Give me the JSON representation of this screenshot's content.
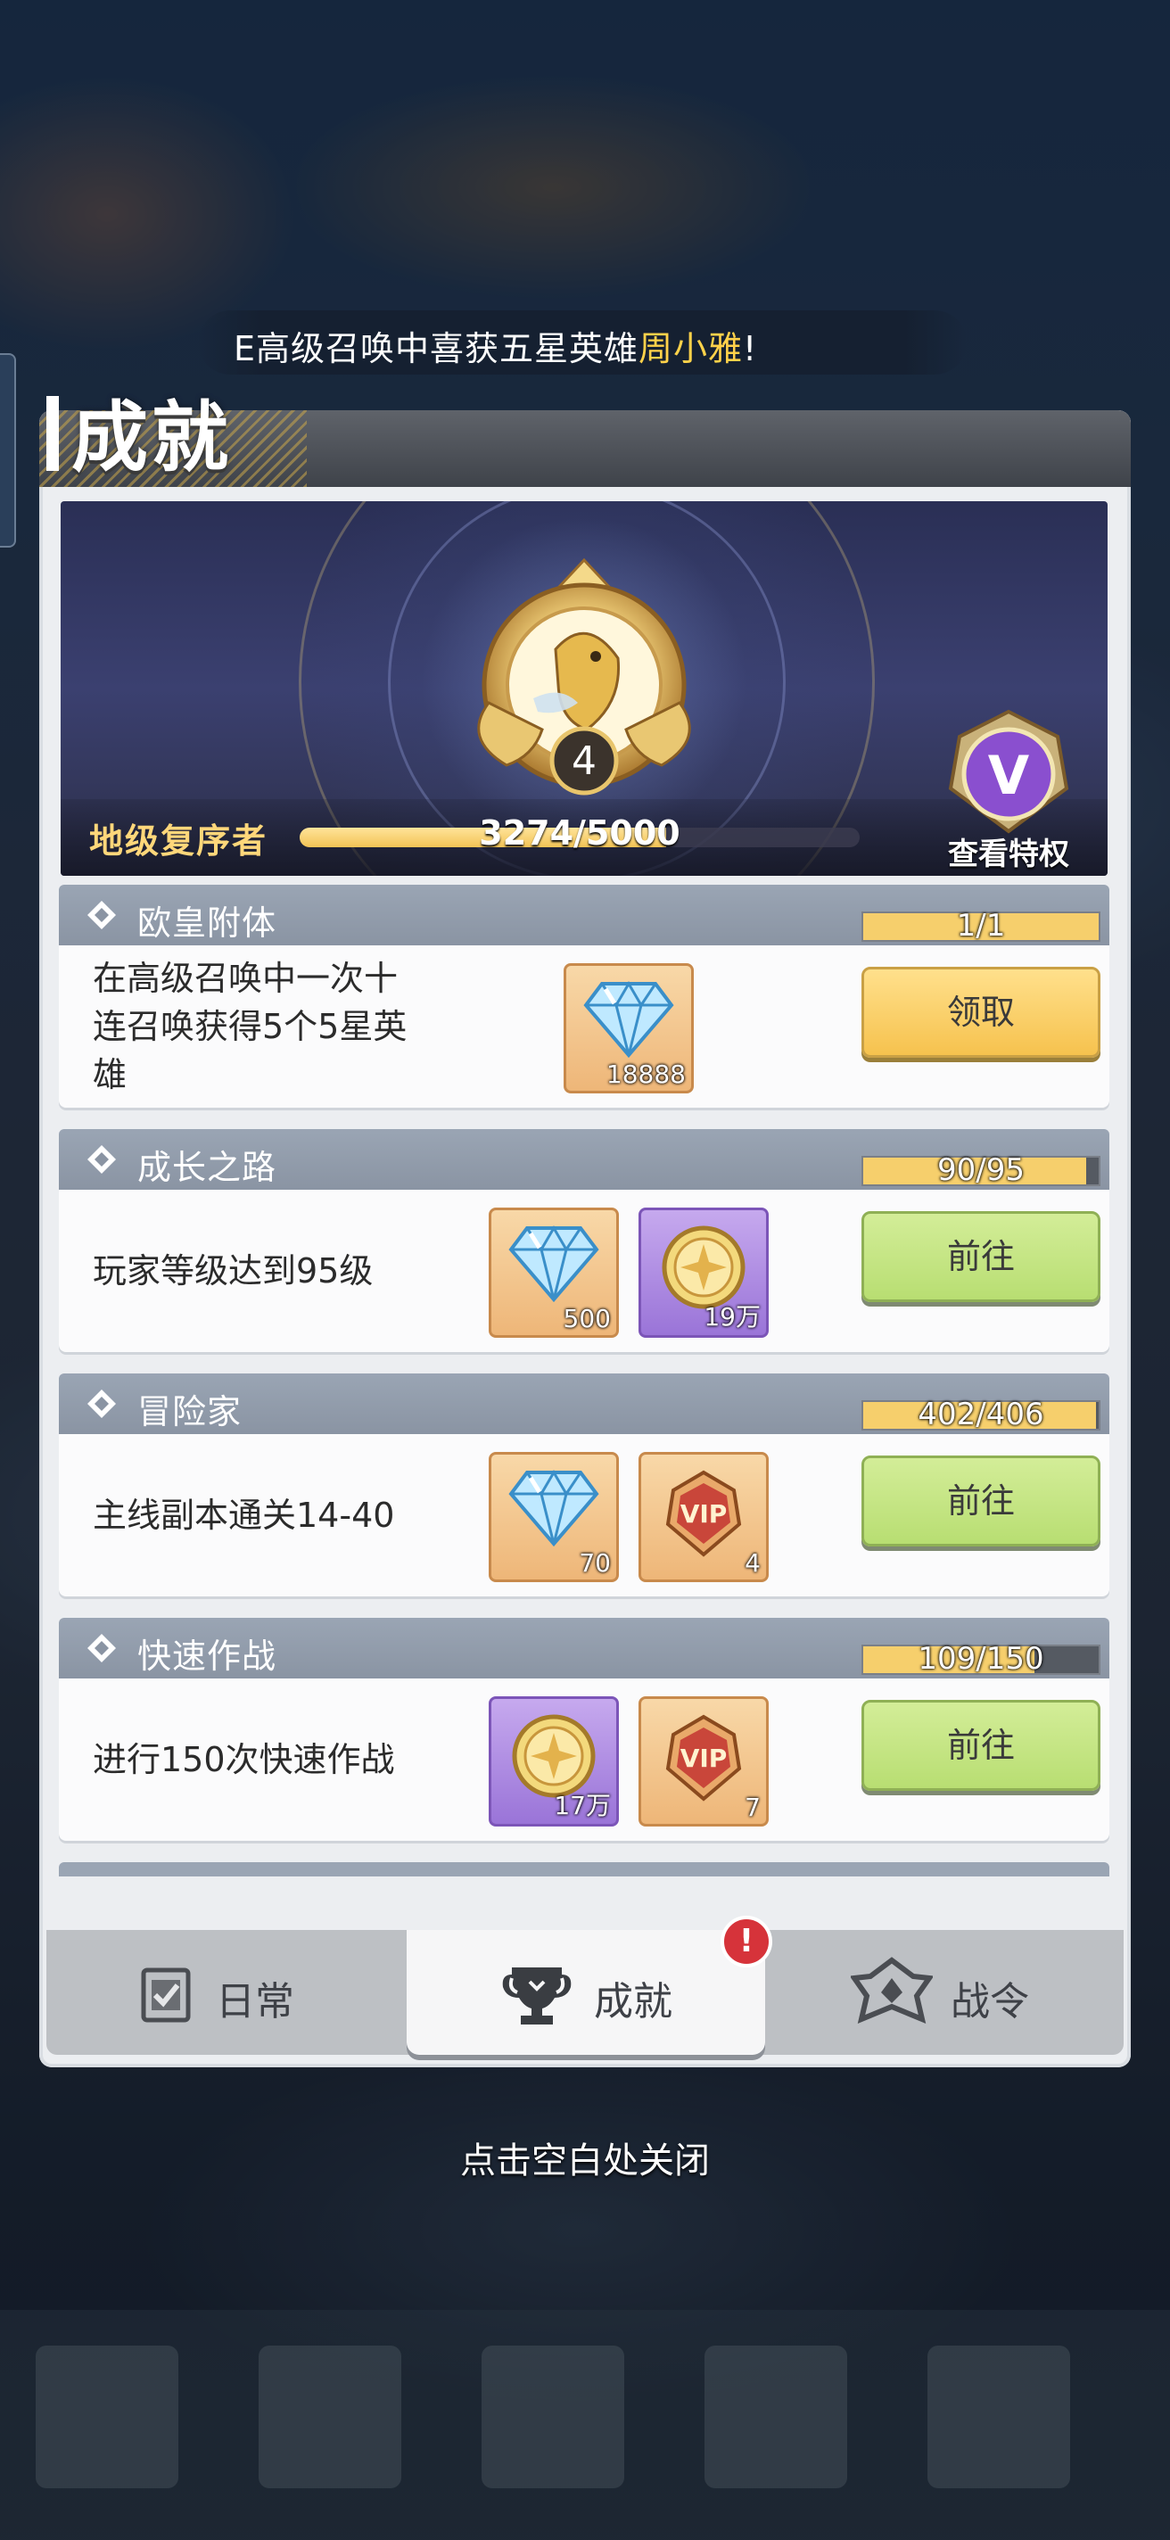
{
  "broadcast": {
    "prefix": "E高级召唤中喜获五星英雄",
    "hero": "周小雅",
    "suffix": "!"
  },
  "title": "成就",
  "banner": {
    "level": "4",
    "rank_name": "地级复序者",
    "exp_text": "3274/5000",
    "exp_fraction": 0.6548,
    "vip_letter": "V",
    "vip_label": "查看特权"
  },
  "achievements": [
    {
      "category": "欧皇附体",
      "desc_lines": [
        "在高级召唤中一次十",
        "连召唤获得5个5星英",
        "雄"
      ],
      "rewards": [
        {
          "type": "diamond-icon",
          "style": "orange",
          "count": "18888"
        }
      ],
      "progress_text": "1/1",
      "progress_fraction": 1.0,
      "action": "领取",
      "action_kind": "claim"
    },
    {
      "category": "成长之路",
      "desc_lines": [
        "玩家等级达到95级"
      ],
      "rewards": [
        {
          "type": "diamond-icon",
          "style": "orange",
          "count": "500"
        },
        {
          "type": "gold-coin-icon",
          "style": "purple",
          "count": "19万"
        }
      ],
      "progress_text": "90/95",
      "progress_fraction": 0.947,
      "action": "前往",
      "action_kind": "go"
    },
    {
      "category": "冒险家",
      "desc_lines": [
        "主线副本通关14-40"
      ],
      "rewards": [
        {
          "type": "diamond-icon",
          "style": "orange",
          "count": "70"
        },
        {
          "type": "vip-badge-icon",
          "style": "orange",
          "count": "4"
        }
      ],
      "progress_text": "402/406",
      "progress_fraction": 0.99,
      "action": "前往",
      "action_kind": "go"
    },
    {
      "category": "快速作战",
      "desc_lines": [
        "进行150次快速作战"
      ],
      "rewards": [
        {
          "type": "gold-coin-icon",
          "style": "purple",
          "count": "17万"
        },
        {
          "type": "vip-badge-icon",
          "style": "orange",
          "count": "7"
        }
      ],
      "progress_text": "109/150",
      "progress_fraction": 0.727,
      "action": "前往",
      "action_kind": "go"
    }
  ],
  "tabs": [
    {
      "label": "日常",
      "icon": "checklist-icon",
      "active": false
    },
    {
      "label": "成就",
      "icon": "trophy-icon",
      "active": true
    },
    {
      "label": "战令",
      "icon": "battle-pass-icon",
      "active": false
    }
  ],
  "tab_badge": "!",
  "close_hint": "点击空白处关闭",
  "colors": {
    "gold": "#f6c24e",
    "green": "#b8de72",
    "header": "#8a94a3",
    "hero_name": "#ffd24a"
  }
}
